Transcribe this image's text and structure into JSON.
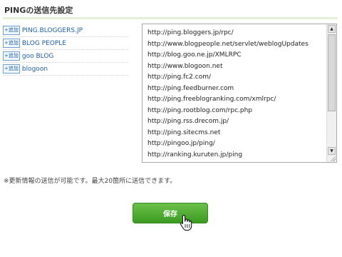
{
  "section": {
    "title": "PINGの送信先設定"
  },
  "ping_services": {
    "add_label": "+追加",
    "items": [
      {
        "label": "PING.BLOGGERS.JP"
      },
      {
        "label": "BLOG PEOPLE"
      },
      {
        "label": "goo BLOG"
      },
      {
        "label": "blogoon"
      }
    ]
  },
  "url_list": {
    "text": "http://ping.bloggers.jp/rpc/\nhttp://www.blogpeople.net/servlet/weblogUpdates\nhttp://blog.goo.ne.jp/XMLRPC\nhttp://www.blogoon.net\nhttp://ping.fc2.com/\nhttp://ping.feedburner.com\nhttp://ping.freeblogranking.com/xmlrpc/\nhttp://ping.rootblog.com/rpc.php\nhttp://ping.rss.drecom.jp/\nhttp://ping.sitecms.net\nhttp://pingoo.jp/ping/\nhttp://ranking.kuruten.jp/ping\nhttp://rpc.blogrolling.com/pinger/"
  },
  "note": "※更新情報の送信が可能です。最大20箇所に送信できます。",
  "save_button": {
    "label": "保存"
  },
  "colors": {
    "button_green": "#4caf2e",
    "link_blue": "#1f5fa6",
    "title_underline": "#e3f2d6"
  },
  "icons": {
    "cursor": "hand-pointer-icon",
    "scroll_up": "arrow-up-icon",
    "scroll_down": "arrow-down-icon"
  }
}
